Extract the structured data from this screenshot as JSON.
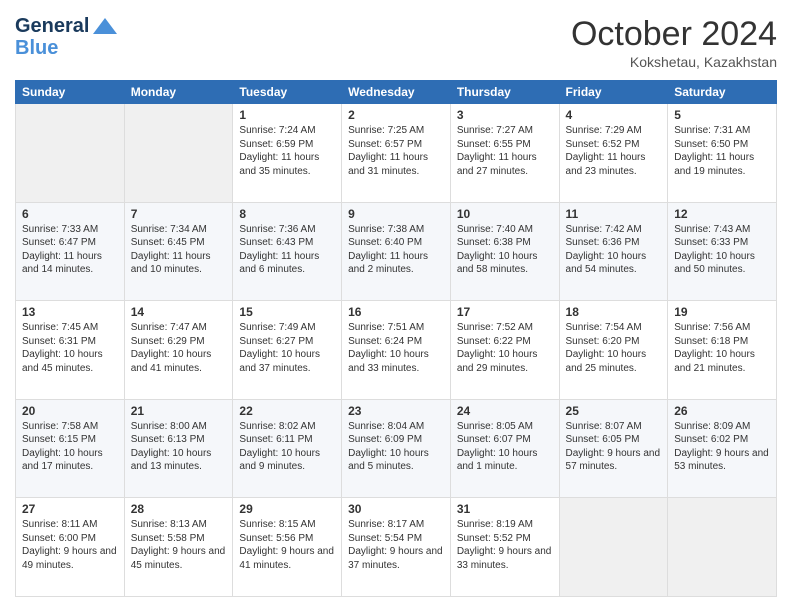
{
  "header": {
    "logo_line1": "General",
    "logo_line2": "Blue",
    "month": "October 2024",
    "location": "Kokshetau, Kazakhstan"
  },
  "weekdays": [
    "Sunday",
    "Monday",
    "Tuesday",
    "Wednesday",
    "Thursday",
    "Friday",
    "Saturday"
  ],
  "weeks": [
    [
      {
        "day": "",
        "info": ""
      },
      {
        "day": "",
        "info": ""
      },
      {
        "day": "1",
        "info": "Sunrise: 7:24 AM\nSunset: 6:59 PM\nDaylight: 11 hours and 35 minutes."
      },
      {
        "day": "2",
        "info": "Sunrise: 7:25 AM\nSunset: 6:57 PM\nDaylight: 11 hours and 31 minutes."
      },
      {
        "day": "3",
        "info": "Sunrise: 7:27 AM\nSunset: 6:55 PM\nDaylight: 11 hours and 27 minutes."
      },
      {
        "day": "4",
        "info": "Sunrise: 7:29 AM\nSunset: 6:52 PM\nDaylight: 11 hours and 23 minutes."
      },
      {
        "day": "5",
        "info": "Sunrise: 7:31 AM\nSunset: 6:50 PM\nDaylight: 11 hours and 19 minutes."
      }
    ],
    [
      {
        "day": "6",
        "info": "Sunrise: 7:33 AM\nSunset: 6:47 PM\nDaylight: 11 hours and 14 minutes."
      },
      {
        "day": "7",
        "info": "Sunrise: 7:34 AM\nSunset: 6:45 PM\nDaylight: 11 hours and 10 minutes."
      },
      {
        "day": "8",
        "info": "Sunrise: 7:36 AM\nSunset: 6:43 PM\nDaylight: 11 hours and 6 minutes."
      },
      {
        "day": "9",
        "info": "Sunrise: 7:38 AM\nSunset: 6:40 PM\nDaylight: 11 hours and 2 minutes."
      },
      {
        "day": "10",
        "info": "Sunrise: 7:40 AM\nSunset: 6:38 PM\nDaylight: 10 hours and 58 minutes."
      },
      {
        "day": "11",
        "info": "Sunrise: 7:42 AM\nSunset: 6:36 PM\nDaylight: 10 hours and 54 minutes."
      },
      {
        "day": "12",
        "info": "Sunrise: 7:43 AM\nSunset: 6:33 PM\nDaylight: 10 hours and 50 minutes."
      }
    ],
    [
      {
        "day": "13",
        "info": "Sunrise: 7:45 AM\nSunset: 6:31 PM\nDaylight: 10 hours and 45 minutes."
      },
      {
        "day": "14",
        "info": "Sunrise: 7:47 AM\nSunset: 6:29 PM\nDaylight: 10 hours and 41 minutes."
      },
      {
        "day": "15",
        "info": "Sunrise: 7:49 AM\nSunset: 6:27 PM\nDaylight: 10 hours and 37 minutes."
      },
      {
        "day": "16",
        "info": "Sunrise: 7:51 AM\nSunset: 6:24 PM\nDaylight: 10 hours and 33 minutes."
      },
      {
        "day": "17",
        "info": "Sunrise: 7:52 AM\nSunset: 6:22 PM\nDaylight: 10 hours and 29 minutes."
      },
      {
        "day": "18",
        "info": "Sunrise: 7:54 AM\nSunset: 6:20 PM\nDaylight: 10 hours and 25 minutes."
      },
      {
        "day": "19",
        "info": "Sunrise: 7:56 AM\nSunset: 6:18 PM\nDaylight: 10 hours and 21 minutes."
      }
    ],
    [
      {
        "day": "20",
        "info": "Sunrise: 7:58 AM\nSunset: 6:15 PM\nDaylight: 10 hours and 17 minutes."
      },
      {
        "day": "21",
        "info": "Sunrise: 8:00 AM\nSunset: 6:13 PM\nDaylight: 10 hours and 13 minutes."
      },
      {
        "day": "22",
        "info": "Sunrise: 8:02 AM\nSunset: 6:11 PM\nDaylight: 10 hours and 9 minutes."
      },
      {
        "day": "23",
        "info": "Sunrise: 8:04 AM\nSunset: 6:09 PM\nDaylight: 10 hours and 5 minutes."
      },
      {
        "day": "24",
        "info": "Sunrise: 8:05 AM\nSunset: 6:07 PM\nDaylight: 10 hours and 1 minute."
      },
      {
        "day": "25",
        "info": "Sunrise: 8:07 AM\nSunset: 6:05 PM\nDaylight: 9 hours and 57 minutes."
      },
      {
        "day": "26",
        "info": "Sunrise: 8:09 AM\nSunset: 6:02 PM\nDaylight: 9 hours and 53 minutes."
      }
    ],
    [
      {
        "day": "27",
        "info": "Sunrise: 8:11 AM\nSunset: 6:00 PM\nDaylight: 9 hours and 49 minutes."
      },
      {
        "day": "28",
        "info": "Sunrise: 8:13 AM\nSunset: 5:58 PM\nDaylight: 9 hours and 45 minutes."
      },
      {
        "day": "29",
        "info": "Sunrise: 8:15 AM\nSunset: 5:56 PM\nDaylight: 9 hours and 41 minutes."
      },
      {
        "day": "30",
        "info": "Sunrise: 8:17 AM\nSunset: 5:54 PM\nDaylight: 9 hours and 37 minutes."
      },
      {
        "day": "31",
        "info": "Sunrise: 8:19 AM\nSunset: 5:52 PM\nDaylight: 9 hours and 33 minutes."
      },
      {
        "day": "",
        "info": ""
      },
      {
        "day": "",
        "info": ""
      }
    ]
  ]
}
